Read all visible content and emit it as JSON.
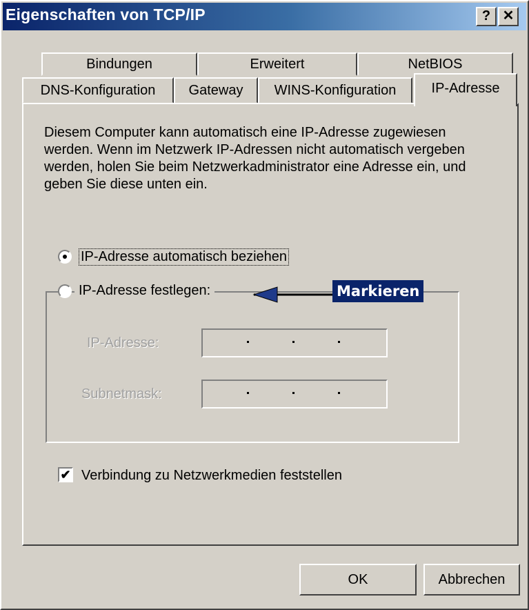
{
  "window": {
    "title": "Eigenschaften von TCP/IP",
    "help_button": "?",
    "close_button": "✕"
  },
  "tabs": {
    "row1": [
      "Bindungen",
      "Erweitert",
      "NetBIOS"
    ],
    "row2": [
      "DNS-Konfiguration",
      "Gateway",
      "WINS-Konfiguration",
      "IP-Adresse"
    ],
    "active": "IP-Adresse"
  },
  "description": "Diesem Computer kann automatisch eine IP-Adresse zugewiesen werden. Wenn im Netzwerk IP-Adressen nicht automatisch vergeben werden, holen Sie beim Netzwerkadministrator eine Adresse ein, und geben Sie diese unten ein.",
  "options": {
    "auto_label": "IP-Adresse automatisch beziehen",
    "manual_label": "IP-Adresse festlegen:",
    "selected": "auto"
  },
  "fields": {
    "ip_label": "IP-Adresse:",
    "subnet_label": "Subnetmask:"
  },
  "checkbox": {
    "label": "Verbindung zu Netzwerkmedien feststellen",
    "checked": true
  },
  "annotation": {
    "text": "Markieren"
  },
  "buttons": {
    "ok": "OK",
    "cancel": "Abbrechen"
  }
}
